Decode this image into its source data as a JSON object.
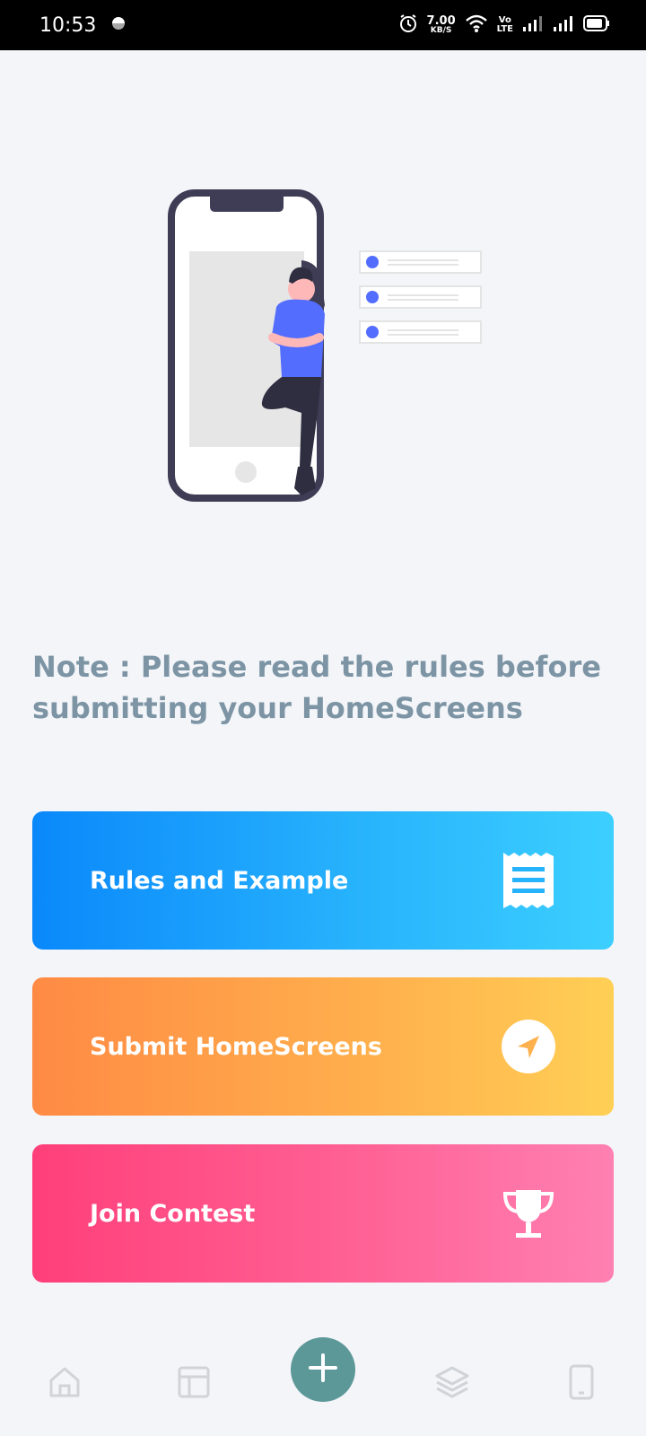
{
  "status_bar": {
    "time": "10:53",
    "net_speed_value": "7.00",
    "net_speed_unit": "KB/S",
    "volte_top": "Vo",
    "volte_bottom": "LTE"
  },
  "note": "Note : Please read the rules before submitting your HomeScreens",
  "actions": [
    {
      "label": "Rules and Example",
      "icon": "receipt-icon",
      "color_start": "#0a88fb",
      "color_end": "#3ccfff"
    },
    {
      "label": "Submit HomeScreens",
      "icon": "navigation-arrow-icon",
      "color_start": "#ff8a44",
      "color_end": "#ffcf55"
    },
    {
      "label": "Join Contest",
      "icon": "trophy-icon",
      "color_start": "#ff3f7a",
      "color_end": "#ff80b2"
    }
  ],
  "bottom_nav": {
    "items": [
      "home-icon",
      "layout-icon",
      "add-icon",
      "layers-icon",
      "phone-icon"
    ],
    "fab_color": "#5d9898"
  }
}
